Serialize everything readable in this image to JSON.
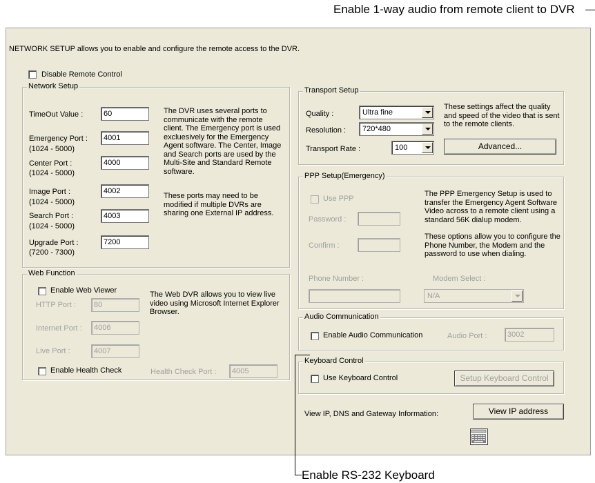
{
  "callouts": {
    "top": "Enable 1-way audio from remote client to DVR",
    "bottom": "Enable RS-232 Keyboard"
  },
  "intro": "NETWORK SETUP allows you to enable and configure the remote access to the DVR.",
  "disable_remote": "Disable Remote Control",
  "network_setup": {
    "title": "Network Setup",
    "timeout_label": "TimeOut Value :",
    "timeout_value": "60",
    "emergency_label": "Emergency Port :",
    "emergency_range": "(1024 - 5000)",
    "emergency_value": "4001",
    "center_label": "Center Port :",
    "center_range": "(1024 - 5000)",
    "center_value": "4000",
    "image_label": "Image Port :",
    "image_range": "(1024 - 5000)",
    "image_value": "4002",
    "search_label": "Search Port :",
    "search_range": "(1024 - 5000)",
    "search_value": "4003",
    "upgrade_label": "Upgrade Port :",
    "upgrade_range": "(7200 - 7300)",
    "upgrade_value": "7200",
    "desc1": "The DVR uses several ports to communicate with the remote client. The Emergency port is used excluesively for the Emergency Agent software. The Center, Image and Search ports are used by the Multi-Site and Standard Remote software.",
    "desc2": "These ports may need to be modified if multiple DVRs are sharing one External IP address."
  },
  "web_function": {
    "title": "Web Function",
    "enable_viewer": "Enable Web Viewer",
    "http_label": "HTTP Port :",
    "http_value": "80",
    "internet_label": "Internet Port :",
    "internet_value": "4006",
    "live_label": "Live Port :",
    "live_value": "4007",
    "desc": "The Web DVR allows you to view live video using Microsoft Internet Explorer Browser.",
    "enable_health": "Enable Health Check",
    "health_label": "Health Check Port :",
    "health_value": "4005"
  },
  "transport": {
    "title": "Transport Setup",
    "quality_label": "Quality :",
    "quality_value": "Ultra fine",
    "resolution_label": "Resolution :",
    "resolution_value": "720*480",
    "rate_label": "Transport Rate :",
    "rate_value": "100",
    "desc": "These settings affect the quality and speed of the video that is sent to the remote clients.",
    "advanced": "Advanced..."
  },
  "ppp": {
    "title": "PPP Setup(Emergency)",
    "use_ppp": "Use PPP",
    "password_label": "Password :",
    "confirm_label": "Confirm :",
    "desc1": "The PPP Emergency Setup is used to transfer the Emergency Agent Software Video across to a remote client using a standard 56K dialup modem.",
    "desc2": "These options allow you to configure the Phone Number, the Modem and the password to use when dialing.",
    "phone_label": "Phone Number :",
    "modem_label": "Modem Select :",
    "modem_value": "N/A"
  },
  "audio": {
    "title": "Audio Communication",
    "enable": "Enable Audio Communication",
    "port_label": "Audio Port :",
    "port_value": "3002"
  },
  "keyboard": {
    "title": "Keyboard Control",
    "use": "Use Keyboard Control",
    "setup": "Setup Keyboard Control"
  },
  "ip_info": {
    "label": "View IP, DNS and Gateway Information:",
    "button": "View  IP address"
  },
  "icons": {
    "keyboard": "keyboard-icon"
  }
}
